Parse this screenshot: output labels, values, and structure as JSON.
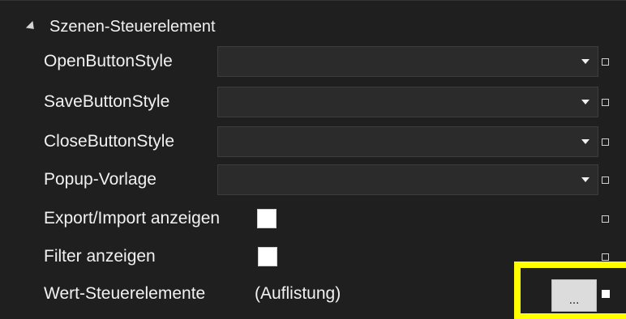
{
  "section": {
    "title": "Szenen-Steuerelement",
    "icon": "collapse-arrow-icon"
  },
  "properties": [
    {
      "label": "OpenButtonStyle",
      "editor": "combo",
      "value": ""
    },
    {
      "label": "SaveButtonStyle",
      "editor": "combo",
      "value": ""
    },
    {
      "label": "CloseButtonStyle",
      "editor": "combo",
      "value": ""
    },
    {
      "label": "Popup-Vorlage",
      "editor": "combo",
      "value": ""
    },
    {
      "label": "Export/Import anzeigen",
      "editor": "checkbox",
      "checked": false
    },
    {
      "label": "Filter anzeigen",
      "editor": "checkbox",
      "checked": false
    },
    {
      "label": "Wert-Steuerelemente",
      "editor": "collection",
      "value": "(Auflistung)",
      "button_label": "..."
    }
  ],
  "colors": {
    "background": "#1f1f1f",
    "highlight": "#ffff00",
    "combo_background": "#2b2b2b",
    "text": "#f1f1f1"
  }
}
